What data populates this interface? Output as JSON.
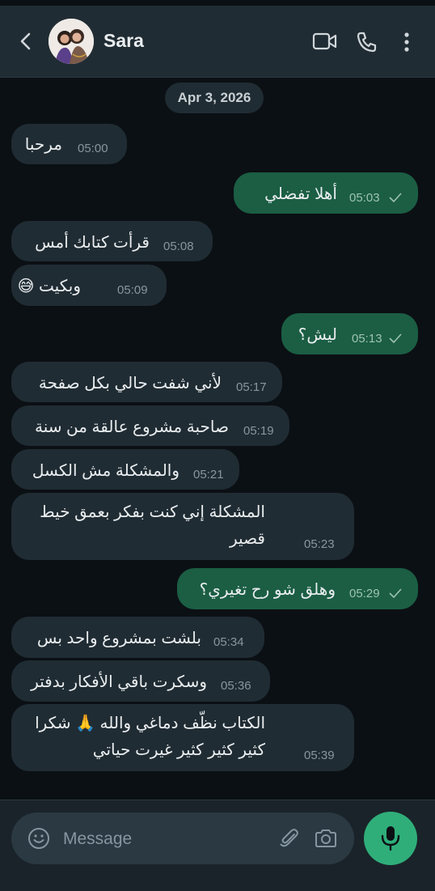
{
  "header": {
    "contact_name": "Sara",
    "icons": [
      "back-arrow-icon",
      "video-call-icon",
      "voice-call-icon",
      "more-options-icon"
    ]
  },
  "date_separator": "Apr 3, 2026",
  "messages": [
    {
      "dir": "in",
      "text": "مرحبا",
      "time": "05:00"
    },
    {
      "dir": "out",
      "text": "أهلا  تفضلي",
      "time": "05:03"
    },
    {
      "dir": "in",
      "text": "قرأت كتابك أمس",
      "time": "05:08"
    },
    {
      "dir": "in",
      "text": "وبكيت 😅",
      "time": "05:09"
    },
    {
      "dir": "out",
      "text": "ليش؟",
      "time": "05:13"
    },
    {
      "dir": "in",
      "text": "لأني شفت حالي بكل صفحة",
      "time": "05:17"
    },
    {
      "dir": "in",
      "text": "صاحبة مشروع عالقة من سنة",
      "time": "05:19"
    },
    {
      "dir": "in",
      "text": "والمشكلة مش الكسل",
      "time": "05:21"
    },
    {
      "dir": "in",
      "text": "المشكلة إني كنت بفكر بعمق خيط قصير",
      "time": "05:23"
    },
    {
      "dir": "out",
      "text": "وهلق شو رح تغيري؟",
      "time": "05:29"
    },
    {
      "dir": "in",
      "text": "بلشت بمشروع واحد بس",
      "time": "05:34"
    },
    {
      "dir": "in",
      "text": "وسكرت باقي الأفكار بدفتر",
      "time": "05:36"
    },
    {
      "dir": "in",
      "text": "الكتاب نظّف دماغي والله 🙏 شكرا كثير كثير كثير غيرت حياتي",
      "time": "05:39"
    }
  ],
  "composer": {
    "placeholder": "Message",
    "icons": [
      "emoji-icon",
      "attach-icon",
      "camera-icon",
      "mic-icon"
    ]
  },
  "colors": {
    "background": "#0b1014",
    "header": "#202c33",
    "incoming_bubble": "#202c33",
    "outgoing_bubble": "#1b5e44",
    "accent": "#2fae7a"
  }
}
